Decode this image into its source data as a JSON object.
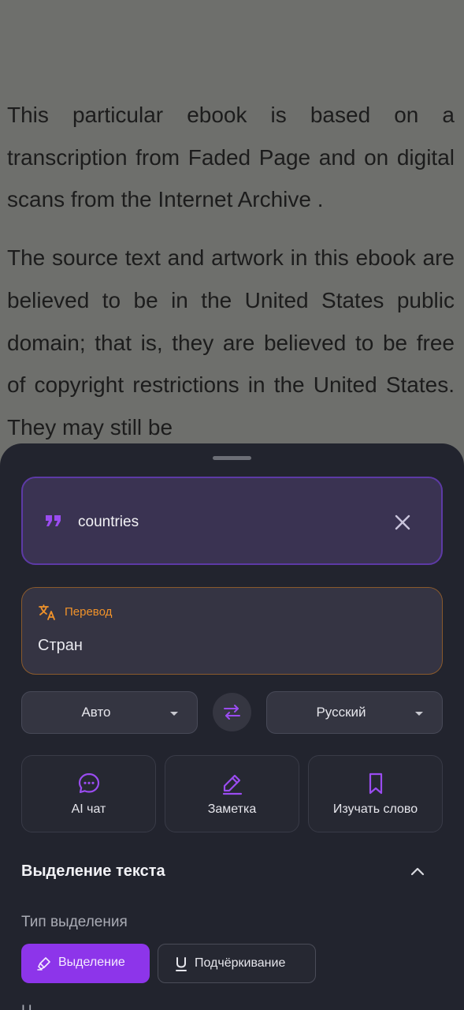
{
  "reader": {
    "paragraph1": "This particular ebook is based on a transcription from Faded Page and on digital scans from the Internet Archive .",
    "paragraph2": "The source text and artwork in this ebook are believed to be in the United States public domain; that is, they are believed to be free of copyright restrictions in the United States. They may still be"
  },
  "quote": {
    "text": "countries",
    "icon": "quote-icon",
    "close_icon": "close-icon"
  },
  "translation": {
    "label": "Перевод",
    "result": "Стран",
    "icon": "translate-icon"
  },
  "languages": {
    "source": "Авто",
    "target": "Русский",
    "swap_icon": "swap-icon"
  },
  "actions": [
    {
      "label": "AI чат",
      "icon": "chat-icon"
    },
    {
      "label": "Заметка",
      "icon": "pencil-icon"
    },
    {
      "label": "Изучать слово",
      "icon": "bookmark-icon"
    }
  ],
  "highlight_section": {
    "title": "Выделение текста",
    "type_label": "Тип выделения",
    "options": [
      {
        "label": "Выделение",
        "icon": "highlighter-icon",
        "selected": true
      },
      {
        "label": "Подчёркивание",
        "icon": "underline-icon",
        "selected": false
      }
    ],
    "next_label_partial": "Ц"
  },
  "colors": {
    "accent_purple": "#8d35ea",
    "accent_orange": "#f0922a",
    "sheet_bg": "#22242e"
  }
}
